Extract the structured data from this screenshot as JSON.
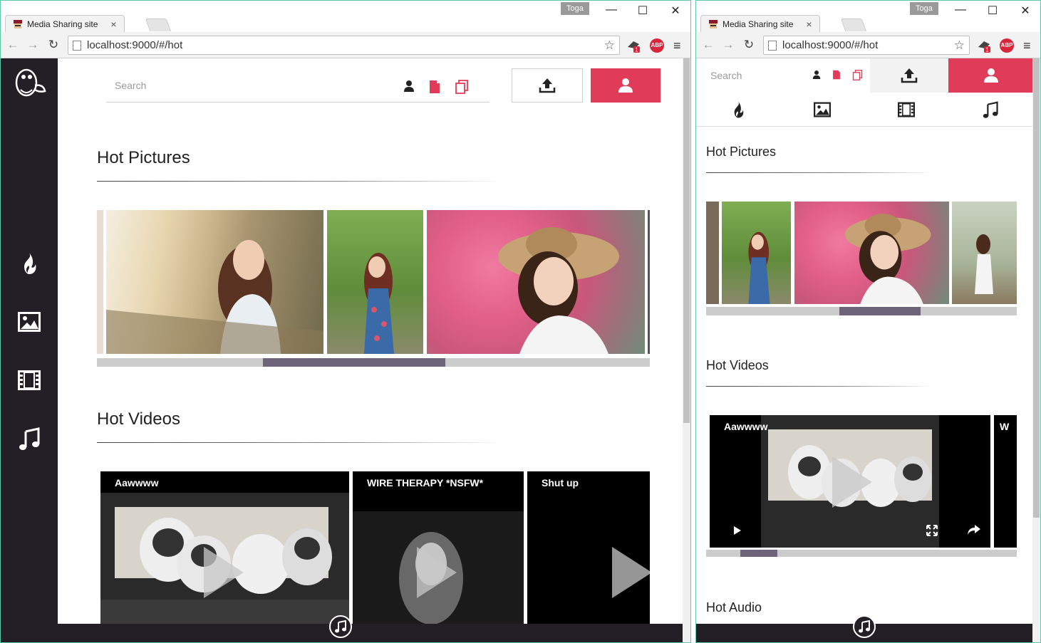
{
  "browser": {
    "tab_title": "Media Sharing site",
    "tab_close": "×",
    "profile_name": "Toga",
    "url": "localhost:9000/#/hot",
    "minimize": "—",
    "maximize": "☐",
    "close": "✕",
    "abp_label": "ABP",
    "ext_badge": "1"
  },
  "search": {
    "placeholder": "Search"
  },
  "sections": {
    "pictures_title": "Hot Pictures",
    "videos_title": "Hot Videos",
    "audio_title": "Hot Audio"
  },
  "videos": [
    {
      "title": "Aawwww"
    },
    {
      "title": "WIRE THERAPY *NSFW*"
    },
    {
      "title": "Shut up"
    }
  ],
  "mobile_videos": [
    {
      "title": "Aawwww"
    },
    {
      "title": "W"
    }
  ],
  "pictures_scroll": {
    "position": 0.3,
    "visible": 0.33
  },
  "mobile_pictures_scroll": {
    "position": 0.43,
    "visible": 0.26
  },
  "mobile_videos_scroll": {
    "position": 0.11,
    "visible": 0.12
  },
  "colors": {
    "accent": "#e03c5a",
    "sidebar": "#231f26",
    "scroll_bar": "#6e647a"
  },
  "nav_icons": [
    "fire-icon",
    "image-icon",
    "film-icon",
    "music-icon"
  ]
}
